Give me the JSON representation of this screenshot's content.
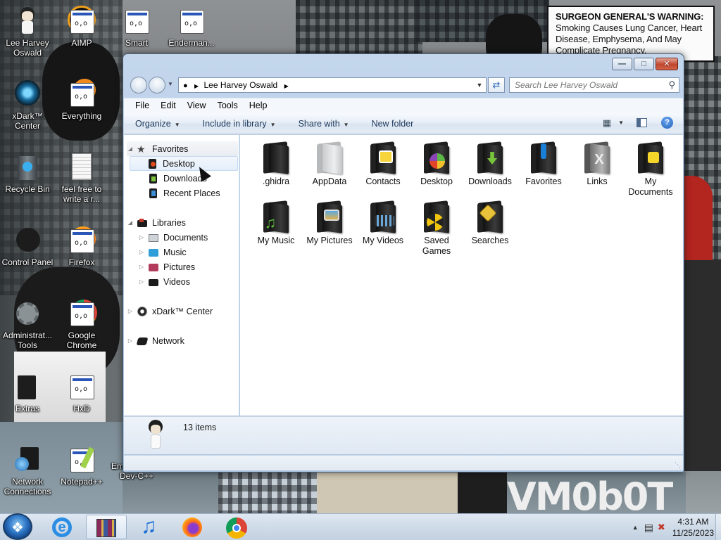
{
  "desktop": {
    "warning": {
      "title": "SURGEON GENERAL'S WARNING:",
      "text": "Smoking Causes Lung Cancer, Heart Disease, Emphysema, And May Complicate Pregnancy."
    },
    "watermark": "VM0b0T",
    "icons": [
      {
        "label": "Lee Harvey Oswald",
        "icon": "user-icon"
      },
      {
        "label": "AIMP",
        "icon": "aimp-icon"
      },
      {
        "label": "Smart",
        "icon": "app-icon"
      },
      {
        "label": "Enderman...",
        "icon": "app-icon"
      },
      {
        "label": "xDark™ Center",
        "icon": "xdark-icon"
      },
      {
        "label": "Everything",
        "icon": "everything-icon"
      },
      {
        "label": "Recycle Bin",
        "icon": "recycle-bin-icon"
      },
      {
        "label": "feel free to write a r...",
        "icon": "text-document-icon"
      },
      {
        "label": "Control Panel",
        "icon": "control-panel-icon"
      },
      {
        "label": "Firefox",
        "icon": "firefox-icon"
      },
      {
        "label": "Administrat... Tools",
        "icon": "admin-tools-icon"
      },
      {
        "label": "Google Chrome",
        "icon": "chrome-icon"
      },
      {
        "label": "Extras",
        "icon": "folder-icon"
      },
      {
        "label": "HxD",
        "icon": "hxd-icon"
      },
      {
        "label": "Network Connections",
        "icon": "network-icon"
      },
      {
        "label": "Notepad++",
        "icon": "notepadpp-icon"
      },
      {
        "label": "Embarcadero Dev-C++",
        "icon": "devcpp-icon"
      }
    ]
  },
  "explorer": {
    "address": {
      "location": "Lee Harvey Oswald"
    },
    "search": {
      "placeholder": "Search Lee Harvey Oswald"
    },
    "menu": [
      "File",
      "Edit",
      "View",
      "Tools",
      "Help"
    ],
    "toolbar": {
      "organize": "Organize",
      "include_in_library": "Include in library",
      "share_with": "Share with",
      "new_folder": "New folder"
    },
    "nav": {
      "favorites": {
        "label": "Favorites",
        "items": [
          "Desktop",
          "Downloads",
          "Recent Places"
        ]
      },
      "libraries": {
        "label": "Libraries",
        "items": [
          "Documents",
          "Music",
          "Pictures",
          "Videos"
        ]
      },
      "xdark": "xDark™ Center",
      "network": "Network"
    },
    "items": [
      {
        "name": ".ghidra",
        "icon": "folder-icon"
      },
      {
        "name": "AppData",
        "icon": "folder-icon"
      },
      {
        "name": "Contacts",
        "icon": "contacts-folder-icon"
      },
      {
        "name": "Desktop",
        "icon": "desktop-folder-icon"
      },
      {
        "name": "Downloads",
        "icon": "downloads-folder-icon"
      },
      {
        "name": "Favorites",
        "icon": "favorites-folder-icon"
      },
      {
        "name": "Links",
        "icon": "links-folder-icon"
      },
      {
        "name": "My Documents",
        "icon": "documents-folder-icon"
      },
      {
        "name": "My Music",
        "icon": "music-folder-icon"
      },
      {
        "name": "My Pictures",
        "icon": "pictures-folder-icon"
      },
      {
        "name": "My Videos",
        "icon": "videos-folder-icon"
      },
      {
        "name": "Saved Games",
        "icon": "saved-games-folder-icon"
      },
      {
        "name": "Searches",
        "icon": "searches-folder-icon"
      }
    ],
    "status": {
      "count": "13 items"
    }
  },
  "taskbar": {
    "pinned": [
      "internet-explorer-icon",
      "winrar-icon",
      "music-icon",
      "firefox-icon",
      "chrome-icon"
    ],
    "clock": {
      "time": "4:31 AM",
      "date": "11/25/2023"
    }
  }
}
